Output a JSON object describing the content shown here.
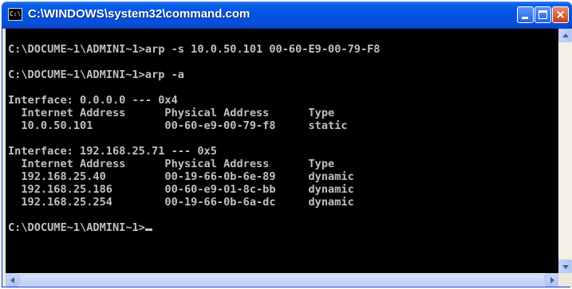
{
  "window": {
    "title": "C:\\WINDOWS\\system32\\command.com",
    "icon_label": "C:\\",
    "buttons": {
      "minimize": "minimize-icon",
      "maximize": "maximize-icon",
      "close": "×"
    }
  },
  "console": {
    "lines": [
      "",
      "C:\\DOCUME~1\\ADMINI~1>arp -s 10.0.50.101 00-60-E9-00-79-F8",
      "",
      "C:\\DOCUME~1\\ADMINI~1>arp -a",
      "",
      "Interface: 0.0.0.0 --- 0x4",
      "  Internet Address      Physical Address      Type",
      "  10.0.50.101           00-60-e9-00-79-f8     static",
      "",
      "Interface: 192.168.25.71 --- 0x5",
      "  Internet Address      Physical Address      Type",
      "  192.168.25.40         00-19-66-0b-6e-89     dynamic",
      "  192.168.25.186        00-60-e9-01-8c-bb     dynamic",
      "  192.168.25.254        00-19-66-0b-6a-dc     dynamic",
      "",
      "C:\\DOCUME~1\\ADMINI~1>"
    ]
  },
  "colors": {
    "console_background": "#000000",
    "console_text": "#c0c0c0",
    "titlebar": "#0054e3"
  }
}
